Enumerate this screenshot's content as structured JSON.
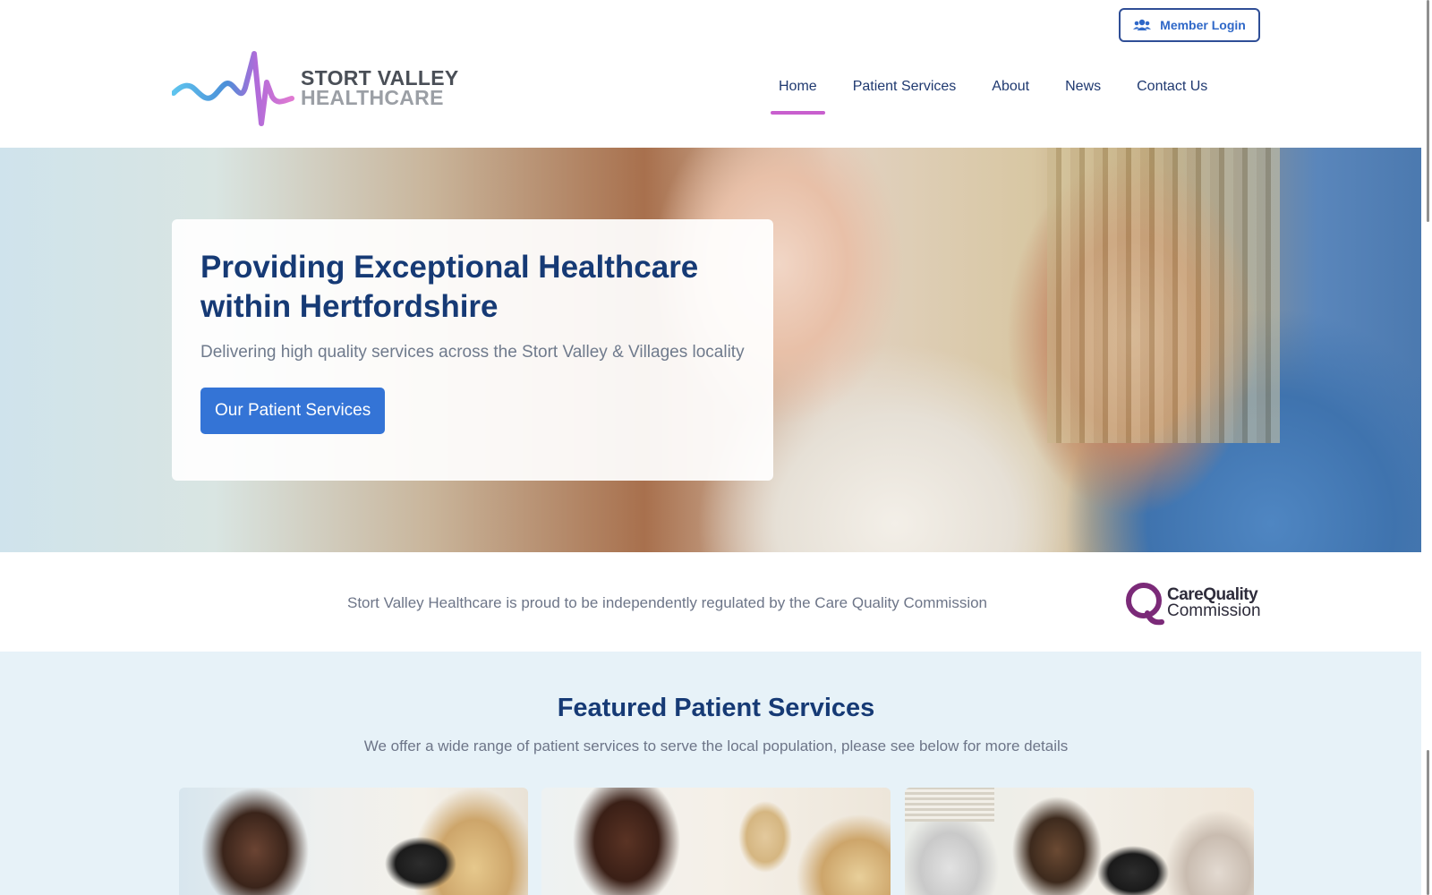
{
  "header": {
    "member_login_label": "Member Login",
    "logo_line1": "STORT VALLEY",
    "logo_line2": "HEALTHCARE",
    "nav": [
      {
        "label": "Home",
        "active": true
      },
      {
        "label": "Patient Services",
        "active": false
      },
      {
        "label": "About",
        "active": false
      },
      {
        "label": "News",
        "active": false
      },
      {
        "label": "Contact Us",
        "active": false
      }
    ]
  },
  "hero": {
    "title": "Providing Exceptional Healthcare within Hertfordshire",
    "subtitle": "Delivering high quality services across the Stort Valley & Villages locality",
    "button_label": "Our Patient Services"
  },
  "cqc": {
    "text": "Stort Valley Healthcare is proud to be independently regulated by the Care Quality Commission",
    "logo_line1": "CareQuality",
    "logo_line2": "Commission"
  },
  "featured": {
    "title": "Featured Patient Services",
    "subtitle": "We offer a wide range of patient services to serve the local population, please see below for more details"
  },
  "colors": {
    "brand_navy": "#163a75",
    "button_blue": "#3474d6",
    "nav_active_underline": "#c85fce",
    "featured_bg": "#e7f2f8",
    "cqc_purple": "#7b2a78"
  },
  "icons": {
    "member_login": "users-icon",
    "logo": "heartbeat-wave-icon"
  }
}
